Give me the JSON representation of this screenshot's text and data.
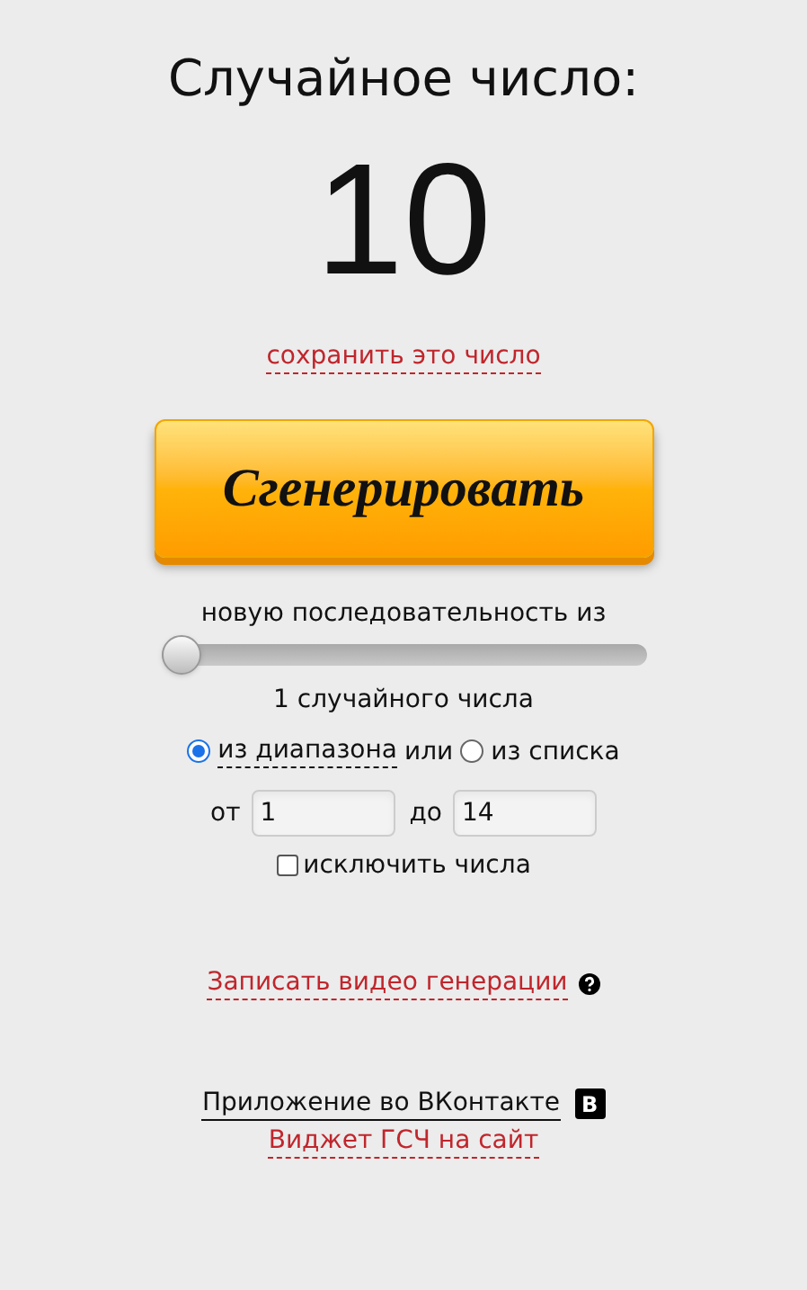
{
  "title": "Случайное число:",
  "result": "10",
  "save_link": "сохранить это число",
  "generate_button": "Сгенерировать",
  "sequence_label": "новую последовательность из",
  "count_slider": {
    "level": 0
  },
  "count_text": "1 случайного числа",
  "modes": [
    {
      "label": "из диапазона",
      "selected": true,
      "dashed": true
    },
    {
      "label": "из списка",
      "selected": false,
      "dashed": false
    }
  ],
  "or_text": "или",
  "range": {
    "from_label": "от",
    "from_value": "1",
    "to_label": "до",
    "to_value": "14"
  },
  "exclude": {
    "label": "исключить числа",
    "checked": false
  },
  "video_link": "Записать видео генерации",
  "vk_app_link": "Приложение во ВКонтакте",
  "vk_badge": "В",
  "widget_link": "Виджет ГСЧ на сайт"
}
